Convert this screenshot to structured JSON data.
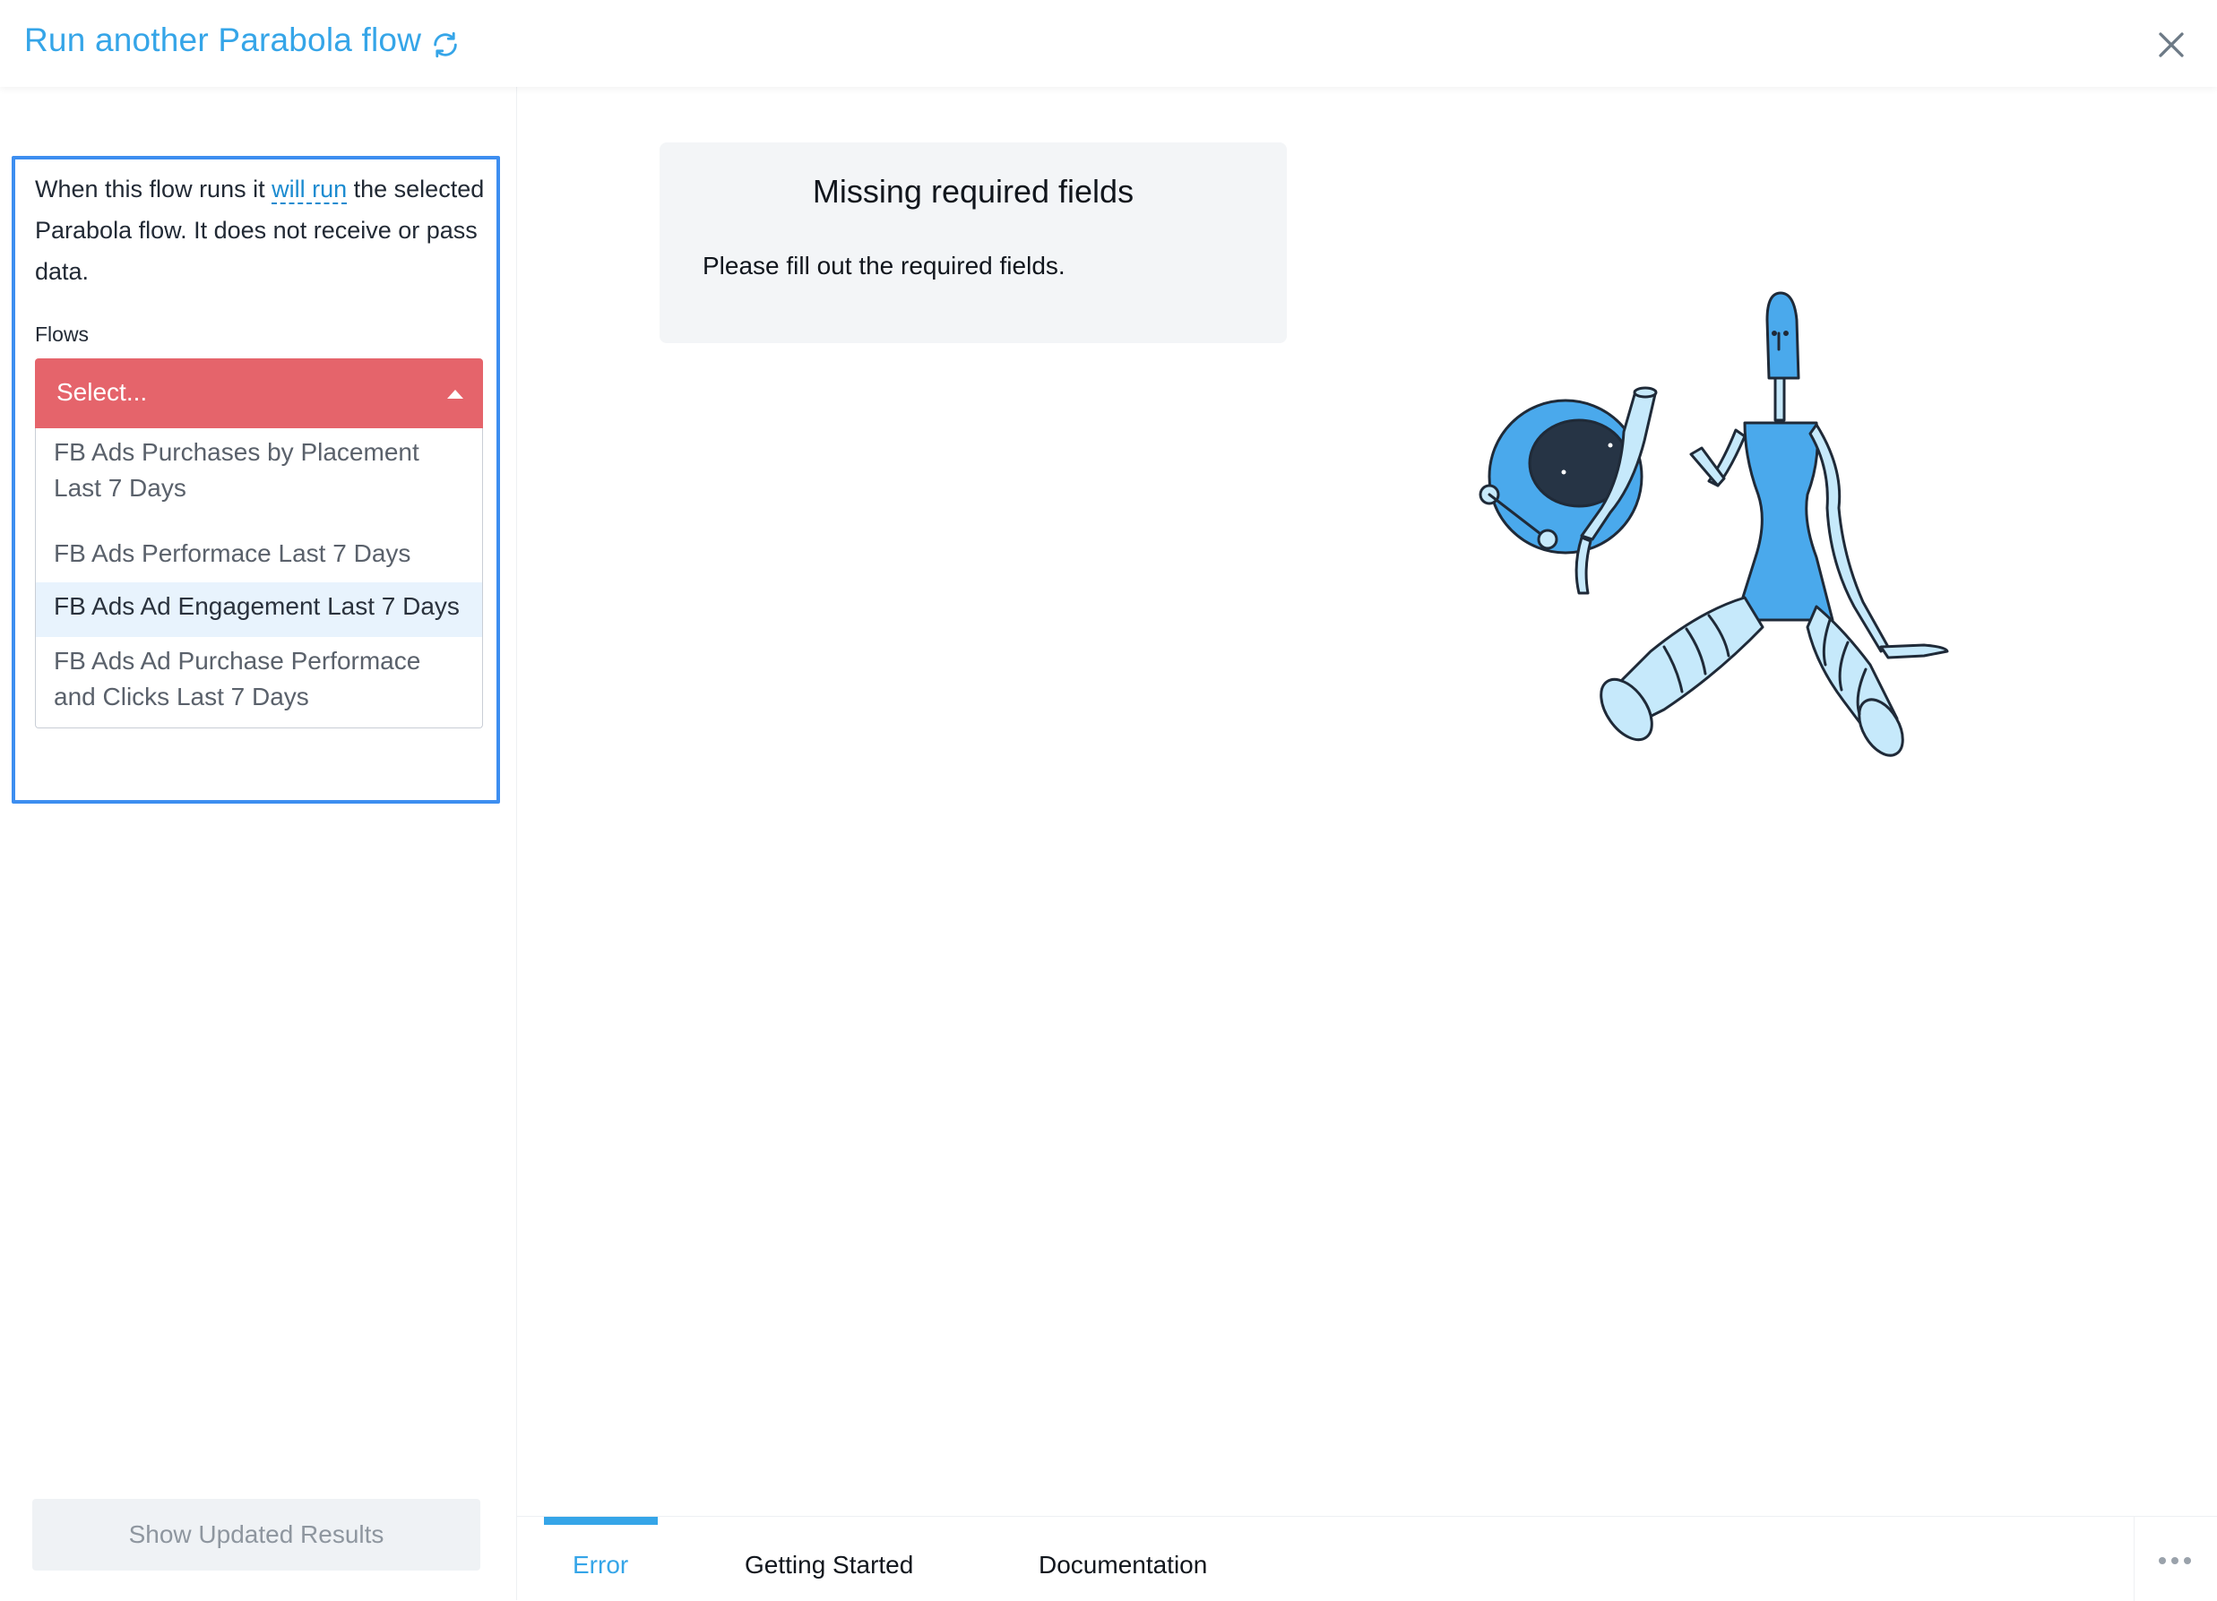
{
  "header": {
    "title": "Run another Parabola flow",
    "refresh_icon": "refresh-icon",
    "close_icon": "close-icon"
  },
  "sidebar": {
    "description_before": "When this flow runs it ",
    "description_link": "will run",
    "description_after": " the selected Parabola flow. It does not receive or pass data.",
    "flows_label": "Flows",
    "select": {
      "placeholder": "Select...",
      "options": [
        "FB Ads Purchases by Placement Last 7 Days",
        "FB Ads Performace Last 7 Days",
        "FB Ads Ad Engagement Last 7 Days",
        "FB Ads Ad Purchase Performace and Clicks Last 7 Days"
      ],
      "highlighted_index": 2
    },
    "show_results_button": "Show Updated Results"
  },
  "main": {
    "error_card": {
      "title": "Missing required fields",
      "message": "Please fill out the required fields."
    },
    "illustration": "robot-illustration"
  },
  "tabs": {
    "items": [
      "Error",
      "Getting Started",
      "Documentation"
    ],
    "active": "Error",
    "more_icon": "more-horizontal-icon"
  },
  "colors": {
    "accent": "#35a5e8",
    "select_error": "#e5646b",
    "focus_border": "#3d8ef0",
    "highlight": "#e8f3fd",
    "robot_blue": "#4aa9ec",
    "robot_light": "#c6e9fb"
  }
}
